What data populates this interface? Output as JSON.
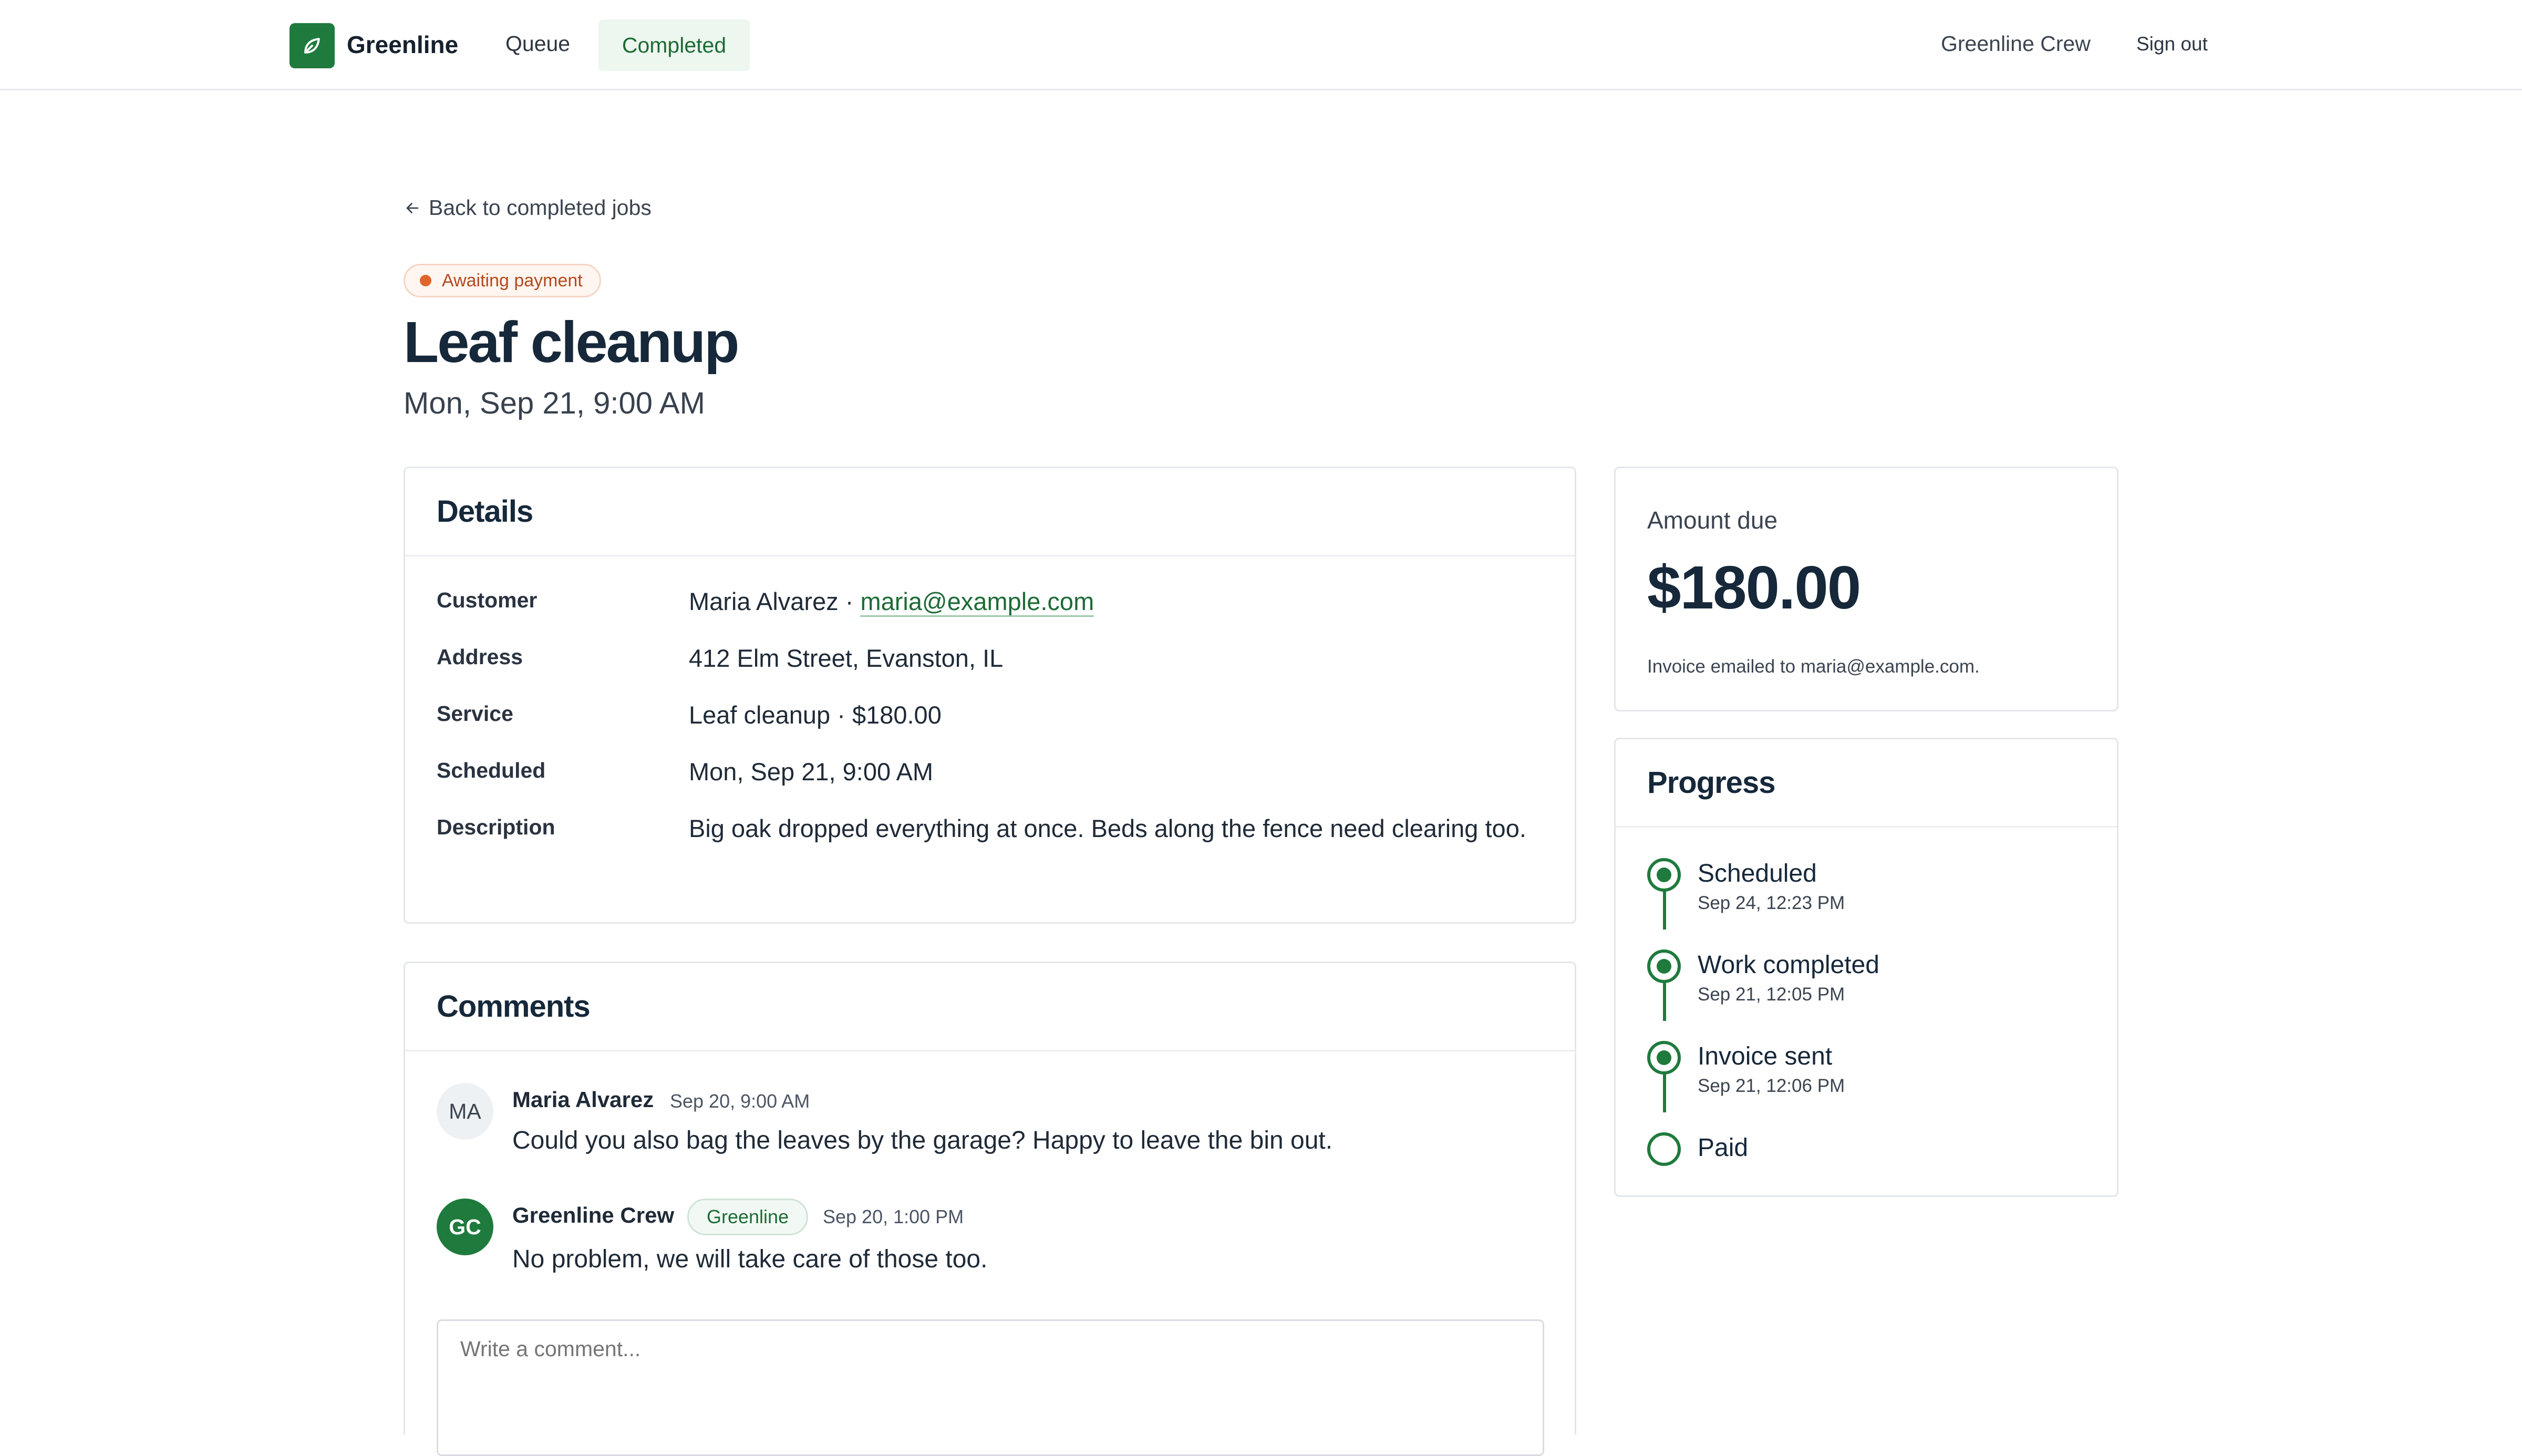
{
  "nav": {
    "brand": "Greenline",
    "queue": "Queue",
    "completed": "Completed",
    "account": "Greenline Crew",
    "sign_out": "Sign out"
  },
  "job": {
    "back_link": "Back to completed jobs",
    "status": "Awaiting payment",
    "title": "Leaf cleanup",
    "datetime": "Mon, Sep 21, 9:00 AM"
  },
  "details": {
    "heading": "Details",
    "customer_label": "Customer",
    "customer_name": "Maria Alvarez ·",
    "customer_email": "maria@example.com",
    "address_label": "Address",
    "address": "412 Elm Street, Evanston, IL",
    "service_label": "Service",
    "service": "Leaf cleanup · $180.00",
    "scheduled_label": "Scheduled",
    "scheduled": "Mon, Sep 21, 9:00 AM",
    "description_label": "Description",
    "description": "Big oak dropped everything at once. Beds along the fence need clearing too."
  },
  "comments": {
    "heading": "Comments",
    "items": [
      {
        "initials": "MA",
        "author": "Maria Alvarez",
        "time": "Sep 20, 9:00 AM",
        "text": "Could you also bag the leaves by the garage? Happy to leave the bin out."
      },
      {
        "initials": "GC",
        "author": "Greenline Crew",
        "tag": "Greenline",
        "time": "Sep 20, 1:00 PM",
        "text": "No problem, we will take care of those too."
      }
    ],
    "placeholder": "Write a comment..."
  },
  "amount": {
    "label": "Amount due",
    "value": "$180.00",
    "note": "Invoice emailed to maria@example.com."
  },
  "progress": {
    "heading": "Progress",
    "steps": [
      {
        "name": "Scheduled",
        "date": "Sep 24, 12:23 PM",
        "done": true
      },
      {
        "name": "Work completed",
        "date": "Sep 21, 12:05 PM",
        "done": true
      },
      {
        "name": "Invoice sent",
        "date": "Sep 21, 12:06 PM",
        "done": true
      },
      {
        "name": "Paid",
        "date": "",
        "done": false
      }
    ]
  },
  "colors": {
    "brand_green": "#1f7a3d",
    "status_orange": "#e0652b",
    "text_dark": "#16283a"
  }
}
